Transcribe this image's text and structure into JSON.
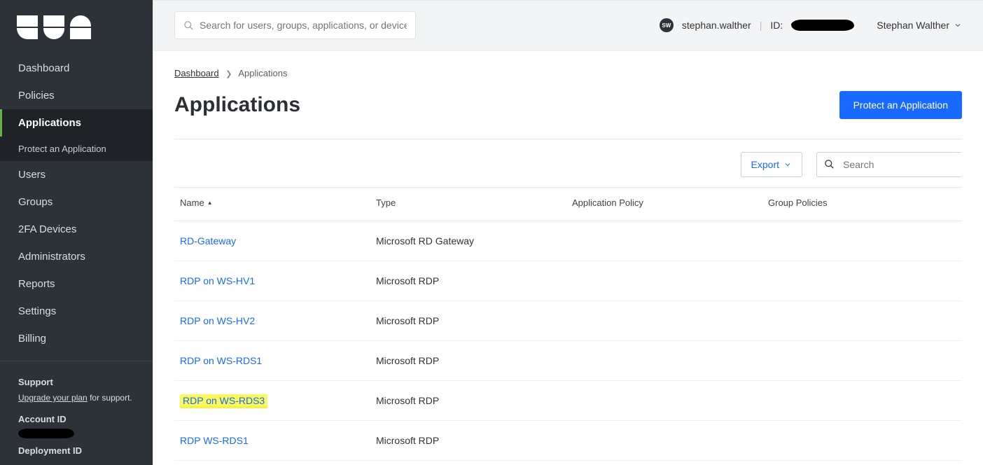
{
  "logo": "DUO",
  "sidebar": {
    "items": [
      {
        "label": "Dashboard",
        "active": false
      },
      {
        "label": "Policies",
        "active": false
      },
      {
        "label": "Applications",
        "active": true,
        "subitems": [
          {
            "label": "Protect an Application"
          }
        ]
      },
      {
        "label": "Users",
        "active": false
      },
      {
        "label": "Groups",
        "active": false
      },
      {
        "label": "2FA Devices",
        "active": false
      },
      {
        "label": "Administrators",
        "active": false
      },
      {
        "label": "Reports",
        "active": false
      },
      {
        "label": "Settings",
        "active": false
      },
      {
        "label": "Billing",
        "active": false
      }
    ],
    "support": {
      "title": "Support",
      "link_text": "Upgrade your plan",
      "suffix": " for support."
    },
    "account_id_label": "Account ID",
    "deployment_id_label": "Deployment ID"
  },
  "topbar": {
    "search_placeholder": "Search for users, groups, applications, or devices",
    "avatar_initials": "SW",
    "user_login": "stephan.walther",
    "id_label": "ID:",
    "display_name": "Stephan Walther"
  },
  "breadcrumb": {
    "root": "Dashboard",
    "current": "Applications"
  },
  "page": {
    "title": "Applications",
    "protect_button": "Protect an Application"
  },
  "toolbar": {
    "export_label": "Export",
    "search_placeholder": "Search"
  },
  "table": {
    "columns": {
      "name": "Name",
      "type": "Type",
      "app_policy": "Application Policy",
      "group_policies": "Group Policies"
    },
    "rows": [
      {
        "name": "RD-Gateway",
        "type": "Microsoft RD Gateway",
        "app_policy": "",
        "group_policies": "",
        "highlight": false
      },
      {
        "name": "RDP on WS-HV1",
        "type": "Microsoft RDP",
        "app_policy": "",
        "group_policies": "",
        "highlight": false
      },
      {
        "name": "RDP on WS-HV2",
        "type": "Microsoft RDP",
        "app_policy": "",
        "group_policies": "",
        "highlight": false
      },
      {
        "name": "RDP on WS-RDS1",
        "type": "Microsoft RDP",
        "app_policy": "",
        "group_policies": "",
        "highlight": false
      },
      {
        "name": "RDP on WS-RDS3",
        "type": "Microsoft RDP",
        "app_policy": "",
        "group_policies": "",
        "highlight": true
      },
      {
        "name": "RDP WS-RDS1",
        "type": "Microsoft RDP",
        "app_policy": "",
        "group_policies": "",
        "highlight": false
      }
    ]
  }
}
